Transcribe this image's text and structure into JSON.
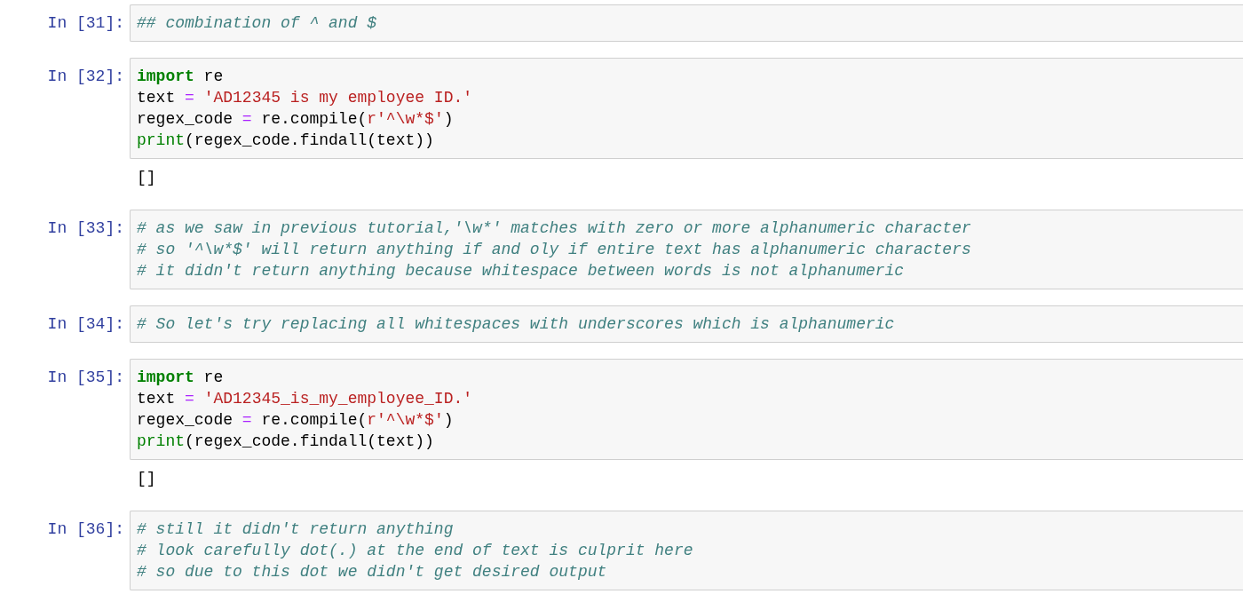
{
  "cells": [
    {
      "prompt": "In [31]:",
      "lines": [
        [
          {
            "kind": "comment",
            "text": "## combination of ^ and $"
          }
        ]
      ]
    },
    {
      "prompt": "In [32]:",
      "lines": [
        [
          {
            "kind": "keyword",
            "text": "import"
          },
          {
            "kind": "plain",
            "text": " re"
          }
        ],
        [
          {
            "kind": "plain",
            "text": "text"
          },
          {
            "kind": "operator",
            "text": " = "
          },
          {
            "kind": "string",
            "text": "'AD12345 is my employee ID.'"
          }
        ],
        [
          {
            "kind": "plain",
            "text": "regex_code "
          },
          {
            "kind": "operator",
            "text": "="
          },
          {
            "kind": "plain",
            "text": " re.compile("
          },
          {
            "kind": "string",
            "text": "r'^\\w*$'"
          },
          {
            "kind": "plain",
            "text": ")"
          }
        ],
        [
          {
            "kind": "builtin",
            "text": "print"
          },
          {
            "kind": "plain",
            "text": "(regex_code.findall(text))"
          }
        ]
      ],
      "output": "[]"
    },
    {
      "prompt": "In [33]:",
      "lines": [
        [
          {
            "kind": "comment",
            "text": "# as we saw in previous tutorial,'\\w*' matches with zero or more alphanumeric character"
          }
        ],
        [
          {
            "kind": "comment",
            "text": "# so '^\\w*$' will return anything if and oly if entire text has alphanumeric characters"
          }
        ],
        [
          {
            "kind": "comment",
            "text": "# it didn't return anything because whitespace between words is not alphanumeric"
          }
        ]
      ]
    },
    {
      "prompt": "In [34]:",
      "lines": [
        [
          {
            "kind": "comment",
            "text": "# So let's try replacing all whitespaces with underscores which is alphanumeric"
          }
        ]
      ]
    },
    {
      "prompt": "In [35]:",
      "lines": [
        [
          {
            "kind": "keyword",
            "text": "import"
          },
          {
            "kind": "plain",
            "text": " re"
          }
        ],
        [
          {
            "kind": "plain",
            "text": "text"
          },
          {
            "kind": "operator",
            "text": " = "
          },
          {
            "kind": "string",
            "text": "'AD12345_is_my_employee_ID.'"
          }
        ],
        [
          {
            "kind": "plain",
            "text": "regex_code "
          },
          {
            "kind": "operator",
            "text": "="
          },
          {
            "kind": "plain",
            "text": " re.compile("
          },
          {
            "kind": "string",
            "text": "r'^\\w*$'"
          },
          {
            "kind": "plain",
            "text": ")"
          }
        ],
        [
          {
            "kind": "builtin",
            "text": "print"
          },
          {
            "kind": "plain",
            "text": "(regex_code.findall(text))"
          }
        ]
      ],
      "output": "[]"
    },
    {
      "prompt": "In [36]:",
      "lines": [
        [
          {
            "kind": "comment",
            "text": "# still it didn't return anything"
          }
        ],
        [
          {
            "kind": "comment",
            "text": "# look carefully dot(.) at the end of text is culprit here"
          }
        ],
        [
          {
            "kind": "comment",
            "text": "# so due to this dot we didn't get desired output"
          }
        ]
      ]
    }
  ]
}
